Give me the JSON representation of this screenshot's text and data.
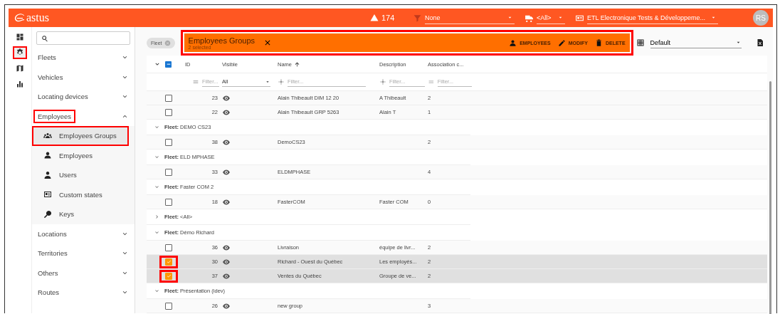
{
  "header": {
    "logo": "astus",
    "alerts": "174",
    "filter": {
      "value": "None"
    },
    "vehicle_filter": {
      "value": "<All>"
    },
    "organization": {
      "value": "ETL Electronique Tests & Développeme..."
    },
    "avatar": "RS"
  },
  "rail": [
    {
      "kind": "dashboard",
      "selected": false,
      "highlighted": false
    },
    {
      "kind": "settings",
      "selected": true,
      "highlighted": true
    },
    {
      "kind": "map",
      "selected": false,
      "highlighted": false
    },
    {
      "kind": "chart",
      "selected": false,
      "highlighted": false
    }
  ],
  "sidebar": {
    "items": [
      {
        "label": "Fleets",
        "expanded": false,
        "highlighted": false
      },
      {
        "label": "Vehicles",
        "expanded": false,
        "highlighted": false
      },
      {
        "label": "Locating devices",
        "expanded": false,
        "highlighted": false
      },
      {
        "label": "Employees",
        "expanded": true,
        "highlighted": true,
        "children": [
          {
            "label": "Employees Groups",
            "kind": "group",
            "selected": true,
            "highlighted": true
          },
          {
            "label": "Employees",
            "kind": "person",
            "selected": false,
            "highlighted": false
          },
          {
            "label": "Users",
            "kind": "user",
            "selected": false,
            "highlighted": false
          },
          {
            "label": "Custom states",
            "kind": "card",
            "selected": false,
            "highlighted": false
          },
          {
            "label": "Keys",
            "kind": "key",
            "selected": false,
            "highlighted": false
          }
        ]
      },
      {
        "label": "Locations",
        "expanded": false,
        "highlighted": false
      },
      {
        "label": "Territories",
        "expanded": false,
        "highlighted": false
      },
      {
        "label": "Others",
        "expanded": false,
        "highlighted": false
      },
      {
        "label": "Routes",
        "expanded": false,
        "highlighted": false
      }
    ]
  },
  "toolbar": {
    "chip": "Fleet",
    "selection": {
      "title": "Employees Groups",
      "subtitle": "2 selected",
      "highlighted": true,
      "actions": [
        {
          "label": "EMPLOYEES",
          "kind": "person"
        },
        {
          "label": "MODIFY",
          "kind": "edit"
        },
        {
          "label": "DELETE",
          "kind": "delete"
        }
      ]
    },
    "view": {
      "value": "Default"
    }
  },
  "table": {
    "select_all": {
      "indeterminate": true
    },
    "columns": [
      {
        "label": "ID"
      },
      {
        "label": "Visible"
      },
      {
        "label": "Name",
        "sort_ascending": true
      },
      {
        "label": "Description"
      },
      {
        "label": "Association c..."
      }
    ],
    "filters": [
      {
        "kind": "equals",
        "placeholder": "Filter..."
      },
      {
        "kind": "select",
        "value": "All"
      },
      {
        "kind": "contains",
        "placeholder": "Filter..."
      },
      {
        "kind": "contains",
        "placeholder": "Filter..."
      },
      {
        "kind": "equals",
        "placeholder": "Filter..."
      }
    ],
    "rows": [
      {
        "kind": "row",
        "id": "23",
        "name": "Alain Thibeault DIM 12 20",
        "description": "A Thibeault",
        "count": "2",
        "checked": false,
        "selected": false,
        "highlighted": false
      },
      {
        "kind": "row",
        "id": "22",
        "name": "Alain Thibeault GRP 5263",
        "description": "Alain T",
        "count": "1",
        "checked": false,
        "selected": false,
        "highlighted": false
      },
      {
        "kind": "group",
        "label": "**Fleet:** DEMO CS23",
        "expanded": true
      },
      {
        "kind": "row",
        "id": "38",
        "name": "DemoCS23",
        "count": "2",
        "checked": false,
        "selected": false,
        "highlighted": false
      },
      {
        "kind": "group",
        "label": "**Fleet:** ELD MPHASE",
        "expanded": true
      },
      {
        "kind": "row",
        "id": "33",
        "name": "ELDMPHASE",
        "count": "4",
        "checked": false,
        "selected": false,
        "highlighted": false
      },
      {
        "kind": "group",
        "label": "**Fleet:** Faster COM 2",
        "expanded": true
      },
      {
        "kind": "row",
        "id": "18",
        "name": "FasterCOM",
        "description": "Faster COM",
        "count": "0",
        "checked": false,
        "selected": false,
        "highlighted": false
      },
      {
        "kind": "group",
        "label": "**Fleet:** <All>",
        "expanded": false
      },
      {
        "kind": "group",
        "label": "**Fleet:** Démo Richard",
        "expanded": true
      },
      {
        "kind": "row",
        "id": "36",
        "name": "Livraison",
        "description": "équipe de livr...",
        "count": "2",
        "checked": false,
        "selected": false,
        "highlighted": false
      },
      {
        "kind": "row",
        "id": "30",
        "name": "Richard - Ouest du Québec",
        "description": "Les employés...",
        "count": "2",
        "checked": true,
        "selected": true,
        "highlighted": true
      },
      {
        "kind": "row",
        "id": "37",
        "name": "Ventes du Québec",
        "description": "Groupe de ve...",
        "count": "2",
        "checked": true,
        "selected": true,
        "highlighted": true
      },
      {
        "kind": "group",
        "label": "**Fleet:** Présentation (idev)",
        "expanded": true
      },
      {
        "kind": "row",
        "id": "26",
        "name": "new group",
        "count": "3",
        "checked": false,
        "selected": false,
        "highlighted": false
      }
    ]
  }
}
